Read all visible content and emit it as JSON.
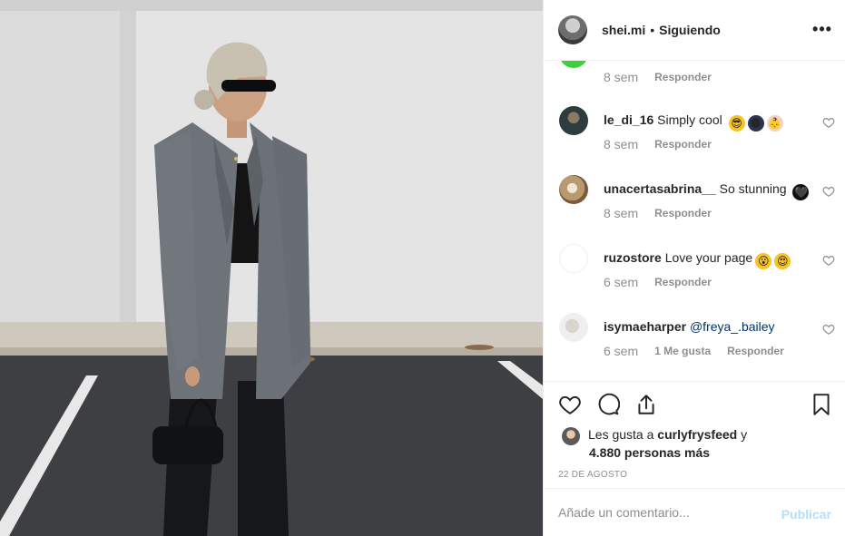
{
  "header": {
    "username": "shei.mi",
    "separator": "•",
    "follow_status": "Siguiendo",
    "more_icon": "more-options-icon"
  },
  "comments": {
    "first_meta": {
      "time": "8 sem",
      "reply": "Responder"
    },
    "items": [
      {
        "username": "le_di_16",
        "text": "Simply cool",
        "emojis": [
          "😎",
          "🌑",
          "👶"
        ],
        "time": "8 sem",
        "reply": "Responder"
      },
      {
        "username": "unacertasabrina__",
        "text": "So stunning",
        "emojis": [
          "🖤"
        ],
        "time": "8 sem",
        "reply": "Responder"
      },
      {
        "username": "ruzostore",
        "text": "Love your page",
        "emojis": [
          "😮",
          "😍"
        ],
        "time": "6 sem",
        "reply": "Responder"
      },
      {
        "username": "isymaeharper",
        "text": "@freya_.bailey",
        "emojis": [],
        "time": "6 sem",
        "likes": "1 Me gusta",
        "reply": "Responder"
      }
    ]
  },
  "actions": {
    "like_icon": "heart-icon",
    "comment_icon": "comment-icon",
    "share_icon": "share-icon",
    "save_icon": "bookmark-icon"
  },
  "likes": {
    "prefix": "Les gusta a",
    "user": "curlyfrysfeed",
    "conj": "y",
    "others": "4.880 personas más"
  },
  "date": "22 DE AGOSTO",
  "add_comment": {
    "placeholder": "Añade un comentario...",
    "post_label": "Publicar"
  },
  "colors": {
    "text": "#262626",
    "muted": "#8e8e8e",
    "post_disabled": "#b2dffc",
    "divider": "#efefef"
  }
}
